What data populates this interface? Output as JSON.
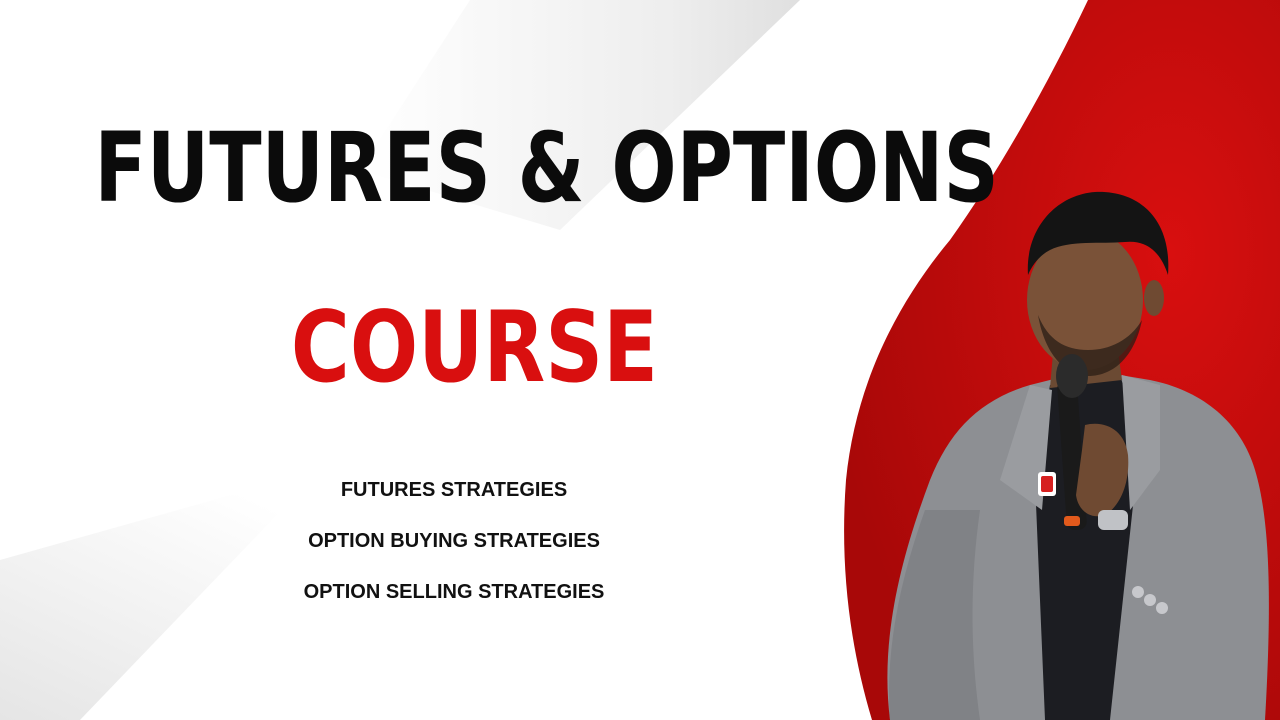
{
  "title": {
    "line1": "FUTURES & OPTIONS",
    "line2": "COURSE"
  },
  "topics": [
    "FUTURES STRATEGIES",
    "OPTION BUYING STRATEGIES",
    "OPTION SELLING STRATEGIES"
  ],
  "colors": {
    "accent_red": "#d90f0f",
    "dark_red": "#b50a0a",
    "title_black": "#0b0b0b",
    "background": "#ffffff",
    "suit_gray": "#8d8f93"
  },
  "image": {
    "presenter": "man-in-gray-suit-holding-microphone"
  }
}
